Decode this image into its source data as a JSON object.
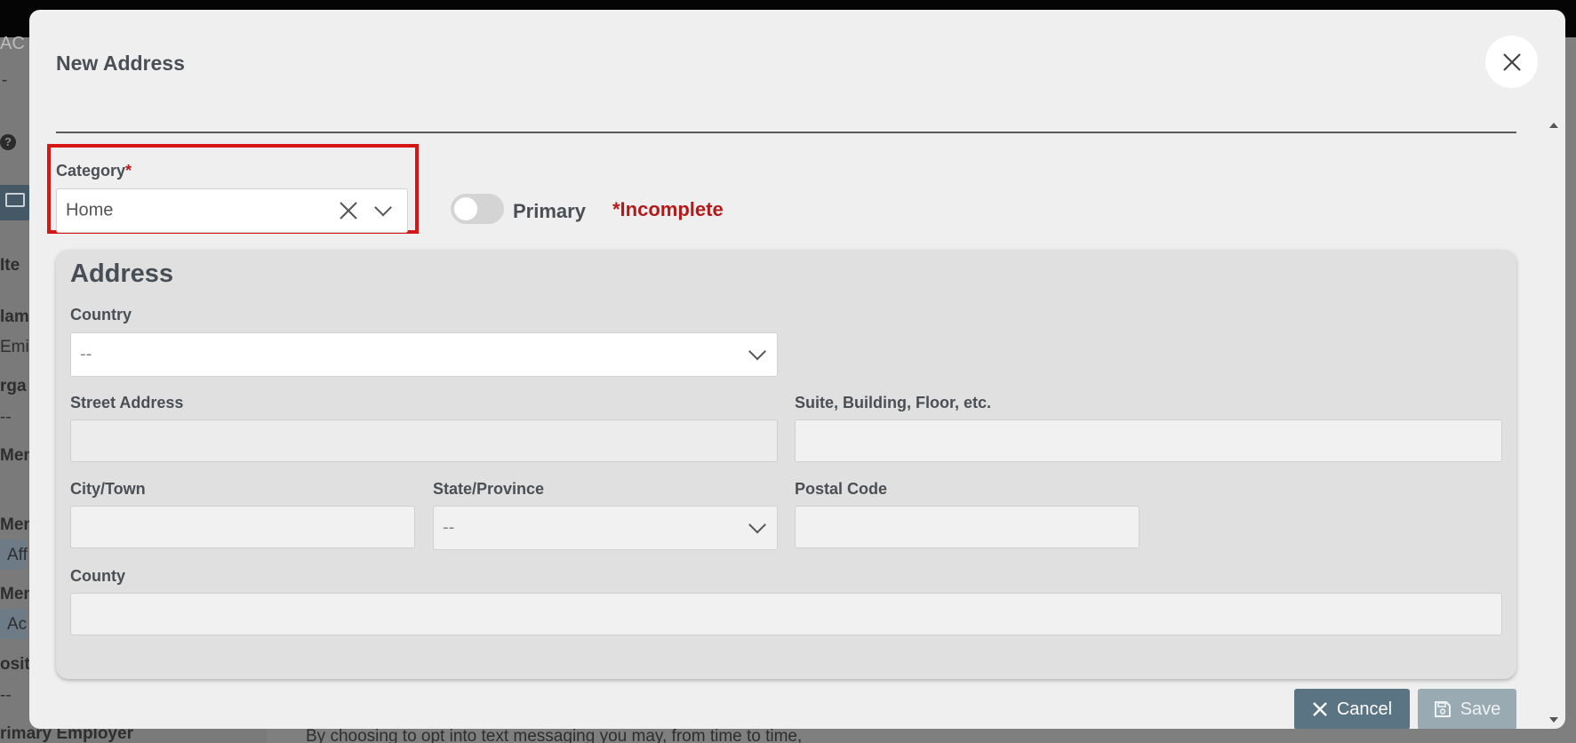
{
  "background": {
    "top_text": "AC",
    "dash": "-",
    "side_fragments": [
      "Ite",
      "lame",
      "Emi",
      "rga",
      "--",
      "Mem",
      "Mem",
      "Aff",
      "Mem",
      "Ac",
      "osit",
      "--"
    ],
    "primary_employer_label": "rimary Employer",
    "footer_text": "By choosing to opt into text messaging you may, from time to time,"
  },
  "modal": {
    "title": "New Address",
    "category": {
      "label": "Category",
      "required_mark": "*",
      "value": "Home"
    },
    "primary_toggle": {
      "label": "Primary",
      "on": false
    },
    "incomplete_text": "*Incomplete",
    "address": {
      "title": "Address",
      "country": {
        "label": "Country",
        "value": "--"
      },
      "street": {
        "label": "Street Address",
        "value": ""
      },
      "suite": {
        "label": "Suite, Building, Floor, etc.",
        "value": ""
      },
      "city": {
        "label": "City/Town",
        "value": ""
      },
      "state": {
        "label": "State/Province",
        "value": "--"
      },
      "postal": {
        "label": "Postal Code",
        "value": ""
      },
      "county": {
        "label": "County",
        "value": ""
      }
    },
    "buttons": {
      "cancel": "Cancel",
      "save": "Save"
    }
  },
  "colors": {
    "required": "#c0171a",
    "incomplete": "#b31a1a",
    "highlight_border": "#d61515",
    "cancel_button": "#5b7483",
    "save_button_disabled": "#9aaab3"
  }
}
